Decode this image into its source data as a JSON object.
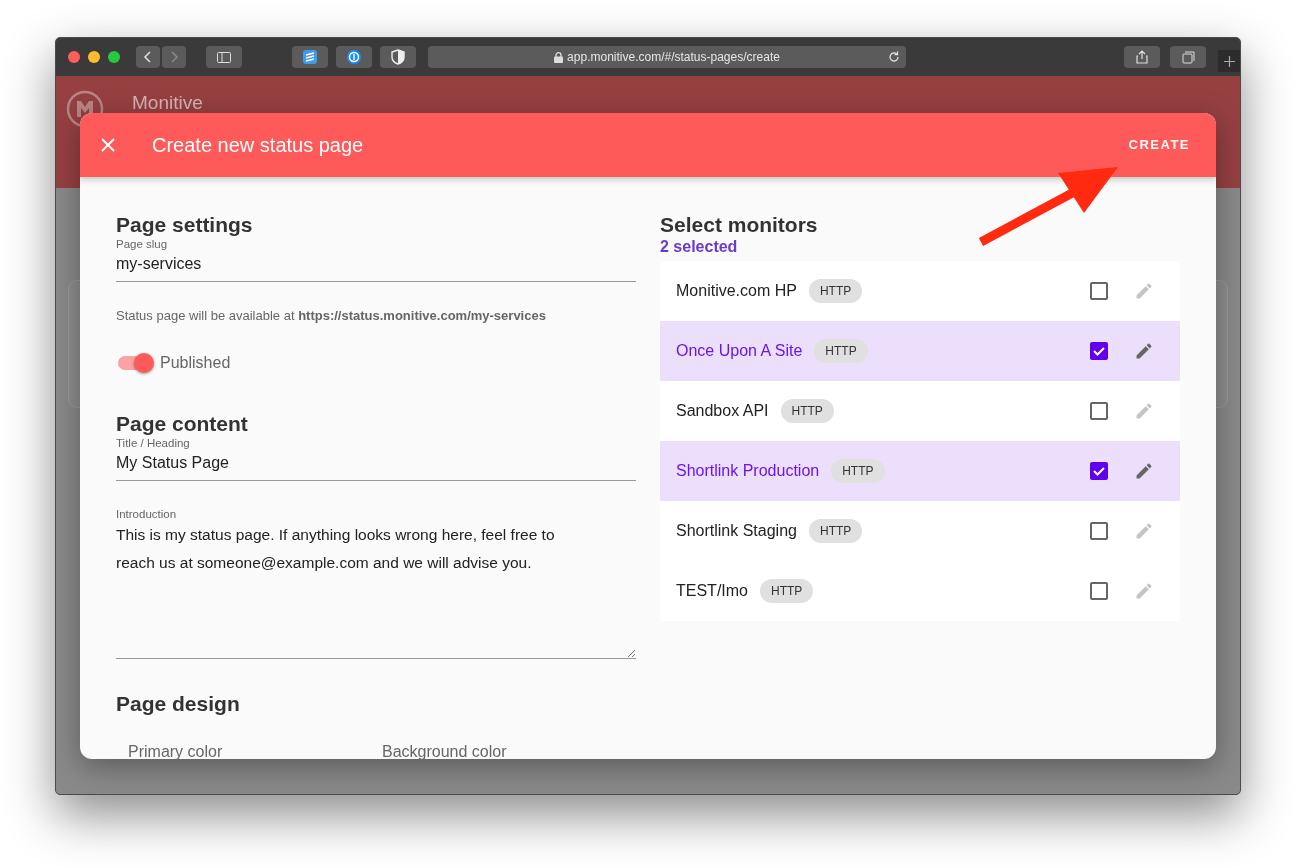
{
  "browser": {
    "url": "app.monitive.com/#/status-pages/create"
  },
  "app": {
    "brand": "Monitive"
  },
  "dialog": {
    "title": "Create new status page",
    "action": "CREATE",
    "page_settings": {
      "heading": "Page settings",
      "slug": {
        "label": "Page slug",
        "value": "my-services"
      },
      "note": "Status page will be available at **https://status.monitive.com/my-services**",
      "published": {
        "label": "Published",
        "on": true
      }
    },
    "page_content": {
      "heading": "Page content",
      "title_field": {
        "label": "Title / Heading",
        "value": "My Status Page"
      },
      "intro": {
        "label": "Introduction",
        "value": "This is my status page. If anything looks wrong here, feel free to reach us at someone@example.com and we will advise you."
      }
    },
    "page_design": {
      "heading": "Page design",
      "fields": [
        "Primary color",
        "Background color"
      ]
    },
    "monitors": {
      "heading": "Select monitors",
      "count": "2 selected",
      "items": [
        {
          "name": "Monitive.com HP",
          "type": "HTTP",
          "selected": false
        },
        {
          "name": "Once Upon A Site",
          "type": "HTTP",
          "selected": true
        },
        {
          "name": "Sandbox API",
          "type": "HTTP",
          "selected": false
        },
        {
          "name": "Shortlink Production",
          "type": "HTTP",
          "selected": true
        },
        {
          "name": "Shortlink Staging",
          "type": "HTTP",
          "selected": false
        },
        {
          "name": "TEST/Imo",
          "type": "HTTP",
          "selected": false
        }
      ]
    }
  }
}
